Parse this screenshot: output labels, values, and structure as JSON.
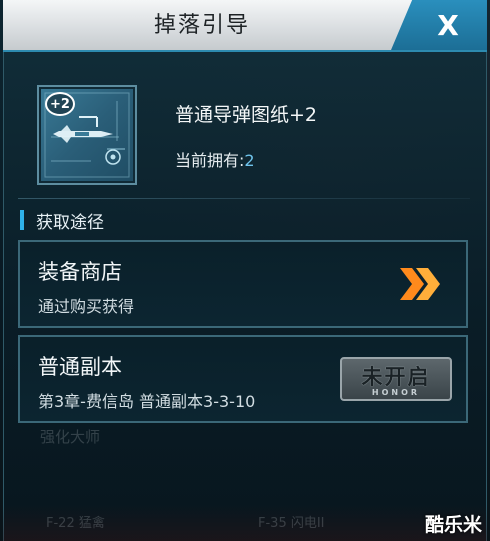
{
  "dialog": {
    "title": "掉落引导",
    "close_label": "X"
  },
  "item": {
    "badge": "+2",
    "name": "普通导弹图纸+2",
    "owned_label": "当前拥有:",
    "owned_count": "2",
    "icon": "missile-blueprint-icon"
  },
  "section": {
    "title": "获取途径"
  },
  "sources": [
    {
      "title": "装备商店",
      "desc": "通过购买获得",
      "action_icon": "double-chevron-right-icon",
      "accent": "#ff8a1c"
    },
    {
      "title": "普通副本",
      "desc": "第3章-费信岛 普通副本3-3-10",
      "status_label": "未开启",
      "status_sub": "HONOR"
    }
  ],
  "background": {
    "faded_label": "强化大师",
    "bottom_left": "F-22 猛禽",
    "bottom_right": "F-35 闪电II"
  },
  "watermark": "酷乐米",
  "colors": {
    "accent_blue": "#2fb2ea",
    "owned_count": "#6fc4ec",
    "close_button": "#1c6e96"
  }
}
